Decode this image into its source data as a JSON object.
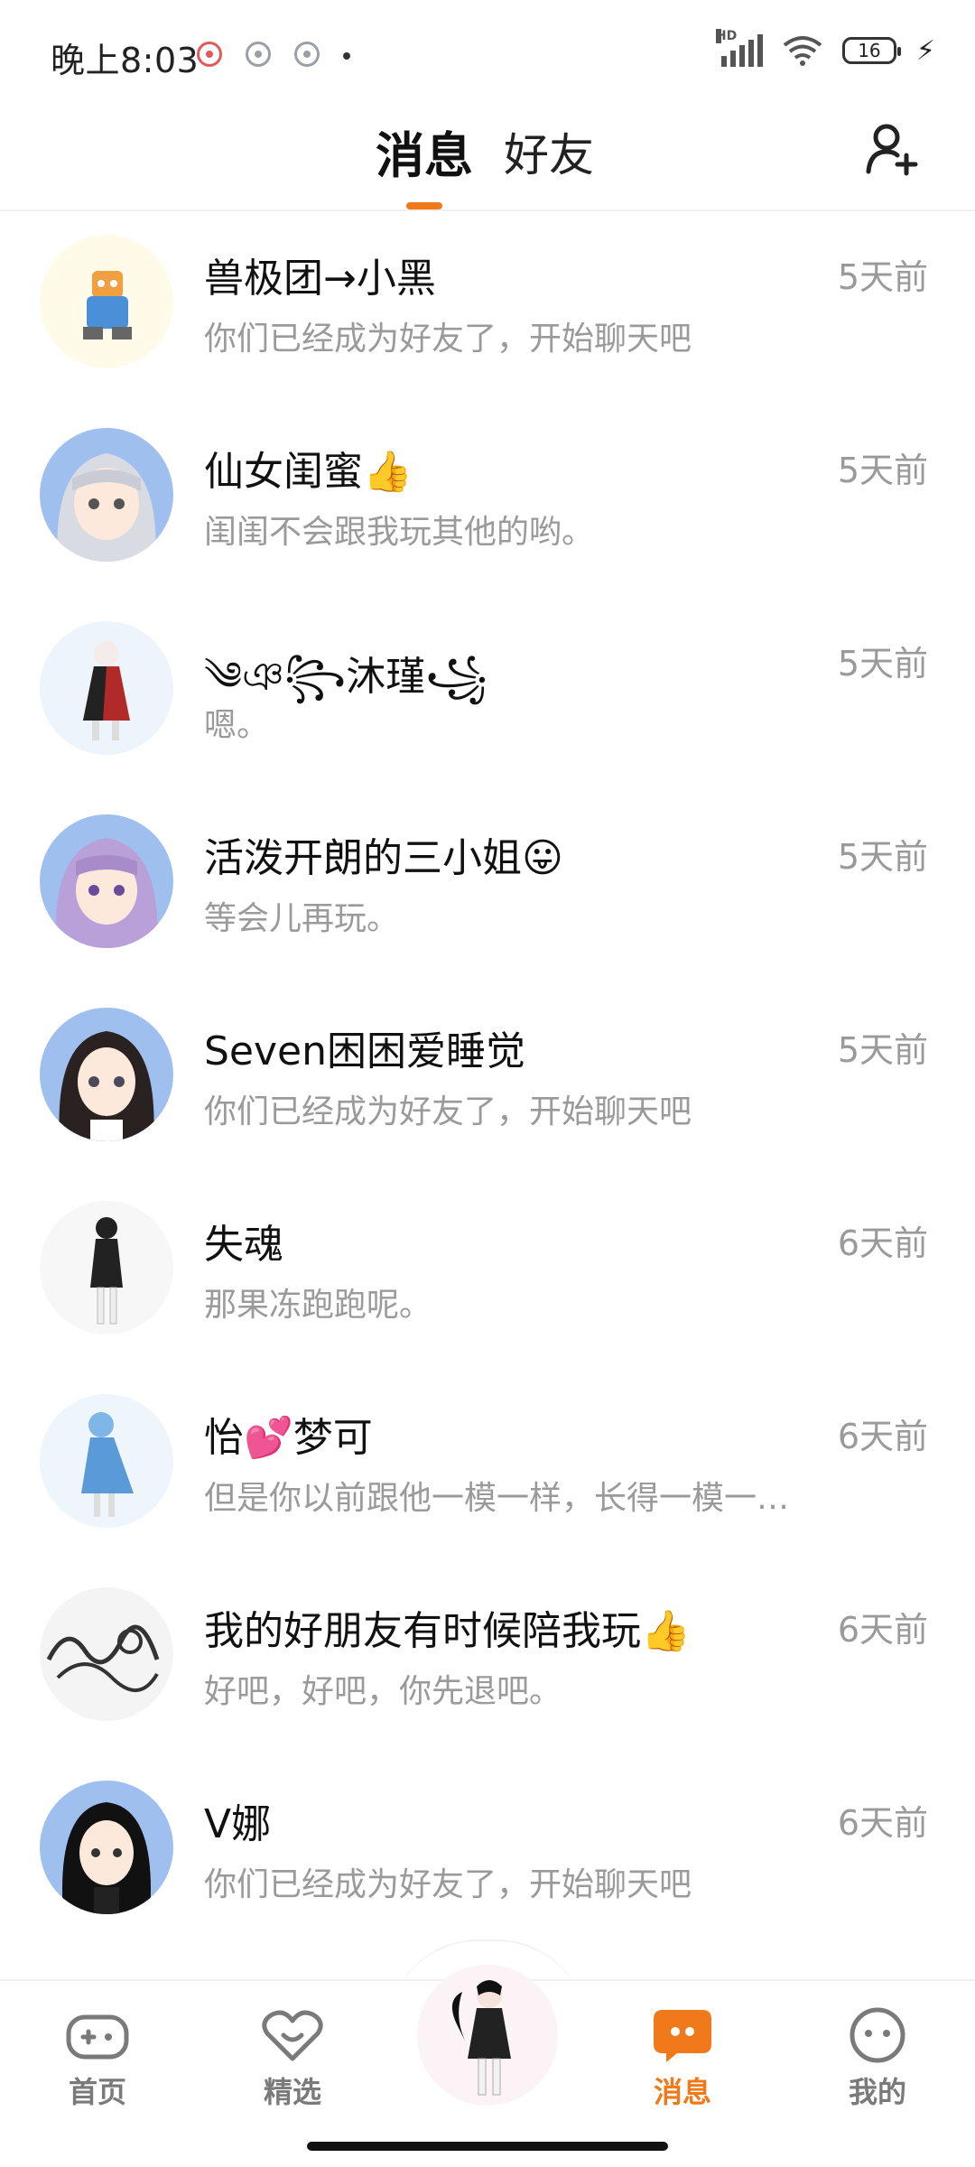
{
  "status_bar": {
    "time": "晚上8:03",
    "network": "HD",
    "battery": "16"
  },
  "header": {
    "tab_active": "消息",
    "tab_inactive": "好友"
  },
  "colors": {
    "accent": "#f07a1a",
    "muted_text": "#9a9a9a"
  },
  "conversations": [
    {
      "name": "兽极团→小黑",
      "time": "5天前",
      "message": "你们已经成为好友了，开始聊天吧",
      "avatar_icon": "robot-character-avatar"
    },
    {
      "name": "仙女闺蜜👍",
      "time": "5天前",
      "message": "闺闺不会跟我玩其他的哟。",
      "avatar_icon": "silver-hair-girl-avatar"
    },
    {
      "name": "༄ঞ꧂沐瑾꧁",
      "time": "5天前",
      "message": "嗯。",
      "avatar_icon": "white-hair-girl-avatar"
    },
    {
      "name": "活泼开朗的三小姐😛",
      "time": "5天前",
      "message": "等会儿再玩。",
      "avatar_icon": "purple-hair-girl-avatar"
    },
    {
      "name": "Seven困困爱睡觉",
      "time": "5天前",
      "message": "你们已经成为好友了，开始聊天吧",
      "avatar_icon": "dark-hair-girl-avatar"
    },
    {
      "name": "失魂",
      "time": "6天前",
      "message": "那果冻跑跑呢。",
      "avatar_icon": "standing-girl-avatar"
    },
    {
      "name": "怡💕梦可",
      "time": "6天前",
      "message": "但是你以前跟他一模一样，长得一模一…",
      "avatar_icon": "blue-hair-girl-avatar"
    },
    {
      "name": "我的好朋友有时候陪我玩👍",
      "time": "6天前",
      "message": "好吧，好吧，你先退吧。",
      "avatar_icon": "calligraphy-avatar"
    },
    {
      "name": "V娜",
      "time": "6天前",
      "message": "你们已经成为好友了，开始聊天吧",
      "avatar_icon": "black-hair-girl-avatar"
    }
  ],
  "bottom_nav": {
    "home": "首页",
    "featured": "精选",
    "messages": "消息",
    "mine": "我的"
  }
}
